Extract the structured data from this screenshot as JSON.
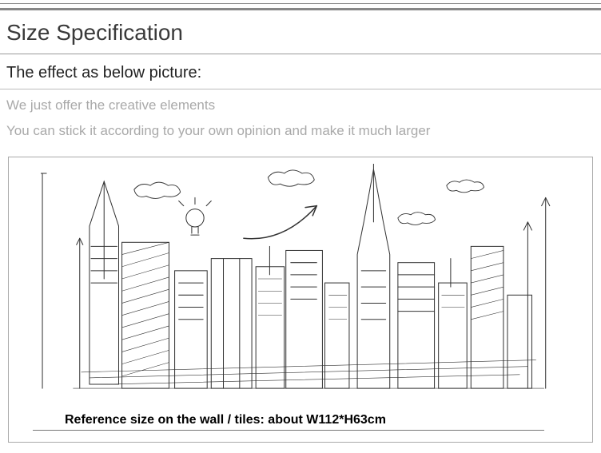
{
  "heading": "Size Specification",
  "subheading": "The effect as below picture:",
  "notes": {
    "line1": "We just offer the creative elements",
    "line2": "You can stick it according to your own opinion and make it much larger"
  },
  "reference_size_label": "Reference size on the wall / tiles: about W112*H63cm"
}
